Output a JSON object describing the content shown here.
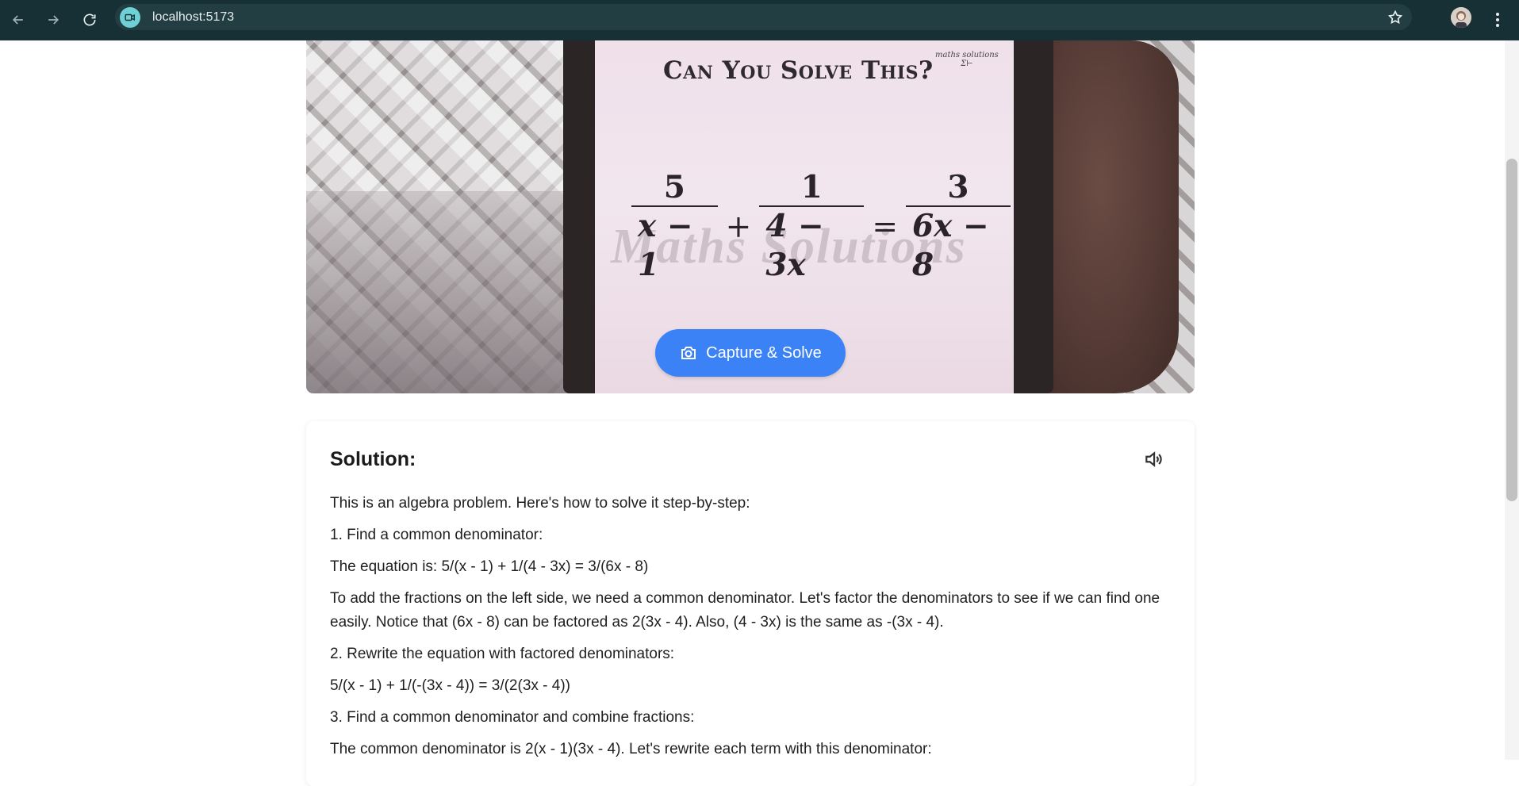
{
  "browser": {
    "url": "localhost:5173",
    "icons": {
      "back": "arrow-left-icon",
      "forward": "arrow-right-icon",
      "reload": "reload-icon",
      "site": "camera-video-icon",
      "bookmark": "star-icon",
      "menu": "kebab-menu-icon"
    }
  },
  "camera": {
    "puzzle_title": "Can You Solve This?",
    "brand_mark_line1": "maths solutions",
    "brand_mark_line2": "Σ⊢",
    "watermark": "Maths Solutions",
    "equation": {
      "f1_num": "5",
      "f1_den": "x − 1",
      "op1": "+",
      "f2_num": "1",
      "f2_den": "4 − 3x",
      "op2": "=",
      "f3_num": "3",
      "f3_den": "6x − 8"
    },
    "capture_button": "Capture & Solve"
  },
  "solution": {
    "title": "Solution:",
    "paragraphs": [
      "This is an algebra problem. Here's how to solve it step-by-step:",
      "1. Find a common denominator:",
      "The equation is: 5/(x - 1) + 1/(4 - 3x) = 3/(6x - 8)",
      "To add the fractions on the left side, we need a common denominator. Let's factor the denominators to see if we can find one easily. Notice that (6x - 8) can be factored as 2(3x - 4). Also, (4 - 3x) is the same as -(3x - 4).",
      "2. Rewrite the equation with factored denominators:",
      "5/(x - 1) + 1/(-(3x - 4)) = 3/(2(3x - 4))",
      "3. Find a common denominator and combine fractions:",
      "The common denominator is 2(x - 1)(3x - 4). Let's rewrite each term with this denominator:"
    ]
  },
  "colors": {
    "chrome_bg": "#163035",
    "accent_button": "#3b82f6",
    "site_badge": "#6fd1d5"
  }
}
